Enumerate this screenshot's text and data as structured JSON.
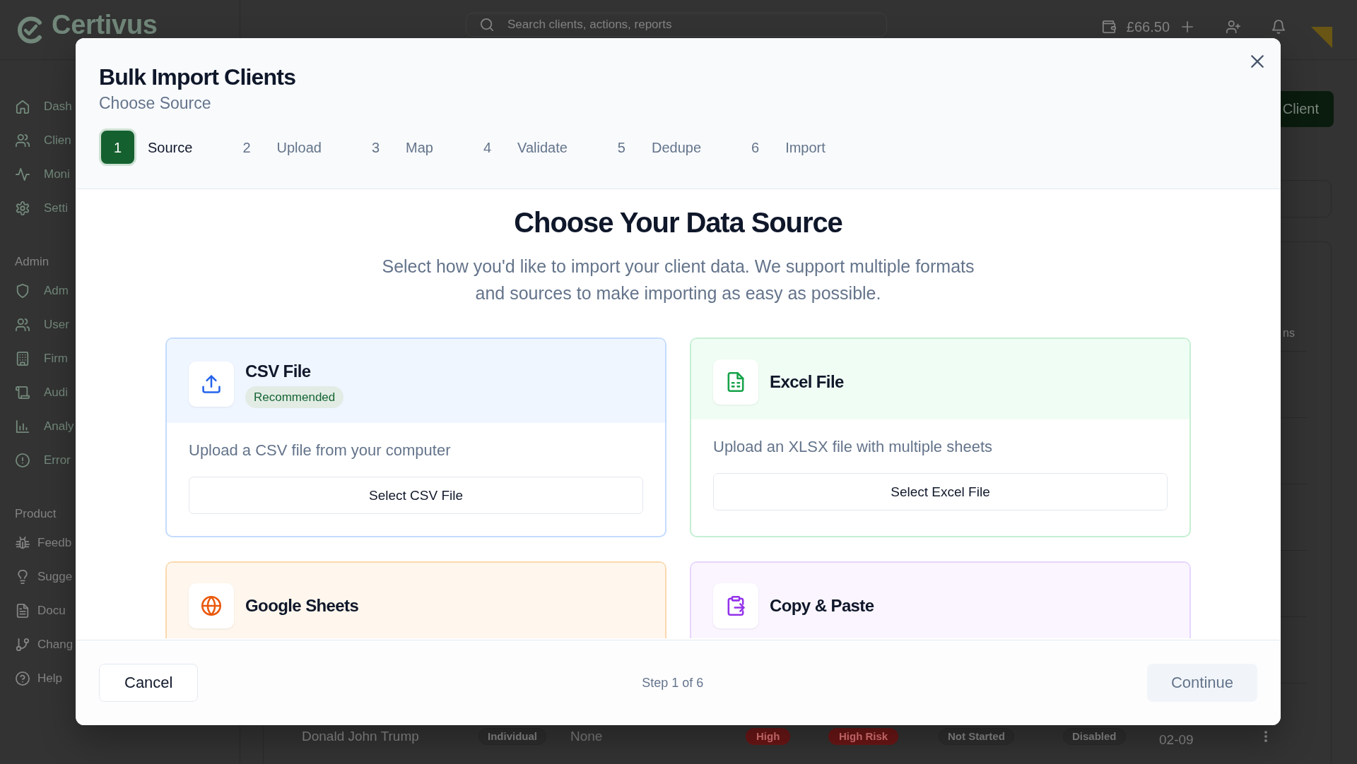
{
  "app": {
    "logo": {
      "name": "Certivus"
    },
    "sidebar": {
      "sections": [
        {
          "items": [
            {
              "label": "Dash"
            },
            {
              "label": "Clien"
            },
            {
              "label": "Moni"
            },
            {
              "label": "Setti"
            }
          ]
        },
        {
          "title": "Admin",
          "items": [
            {
              "label": "Adm"
            },
            {
              "label": "User"
            },
            {
              "label": "Firm"
            },
            {
              "label": "Audi"
            },
            {
              "label": "Analy"
            },
            {
              "label": "Error"
            }
          ]
        },
        {
          "title": "Product",
          "items": [
            {
              "label": "Feedb"
            },
            {
              "label": "Sugge"
            },
            {
              "label": "Docu"
            },
            {
              "label": "Chang"
            },
            {
              "label": "Help"
            }
          ]
        }
      ]
    },
    "topbar": {
      "search": {
        "placeholder": "Search clients, actions, reports"
      },
      "balance": "£66.50"
    },
    "page": {
      "primary_button": "Client",
      "table": {
        "header": {
          "column_9": "ns"
        },
        "rows": [
          {
            "cells": [
              {
                "kind": "name",
                "text": "Donald John Trump"
              },
              {
                "kind": "tag",
                "text": "Individual"
              },
              {
                "kind": "muted",
                "text": "None"
              },
              {
                "kind": "danger",
                "text": "High"
              },
              {
                "kind": "danger",
                "text": "High Risk"
              },
              {
                "kind": "tag",
                "text": "Not Started"
              },
              {
                "kind": "tag",
                "text": "Disabled"
              },
              {
                "kind": "date",
                "text": "02-09"
              }
            ]
          }
        ]
      }
    }
  },
  "modal": {
    "title": "Bulk Import Clients",
    "subtitle": "Choose Source",
    "steps": [
      {
        "number": "1",
        "label": "Source",
        "selected": true
      },
      {
        "number": "2",
        "label": "Upload",
        "selected": false
      },
      {
        "number": "3",
        "label": "Map",
        "selected": false
      },
      {
        "number": "4",
        "label": "Validate",
        "selected": false
      },
      {
        "number": "5",
        "label": "Dedupe",
        "selected": false
      },
      {
        "number": "6",
        "label": "Import",
        "selected": false
      }
    ],
    "heading": "Choose Your Data Source",
    "description": "Select how you'd like to import your client data. We support multiple formats and sources to make importing as easy as possible.",
    "sources": [
      {
        "kind": "csv",
        "title": "CSV File",
        "badge": "Recommended",
        "description": "Upload a CSV file from your computer",
        "button": "Select CSV File"
      },
      {
        "kind": "excel",
        "title": "Excel File",
        "description": "Upload an XLSX file with multiple sheets",
        "button": "Select Excel File"
      },
      {
        "kind": "sheets",
        "title": "Google Sheets"
      },
      {
        "kind": "paste",
        "title": "Copy & Paste"
      }
    ],
    "footer": {
      "cancel": "Cancel",
      "progress": "Step 1 of 6",
      "continue": {
        "label": "Continue",
        "disabled": true
      }
    }
  }
}
